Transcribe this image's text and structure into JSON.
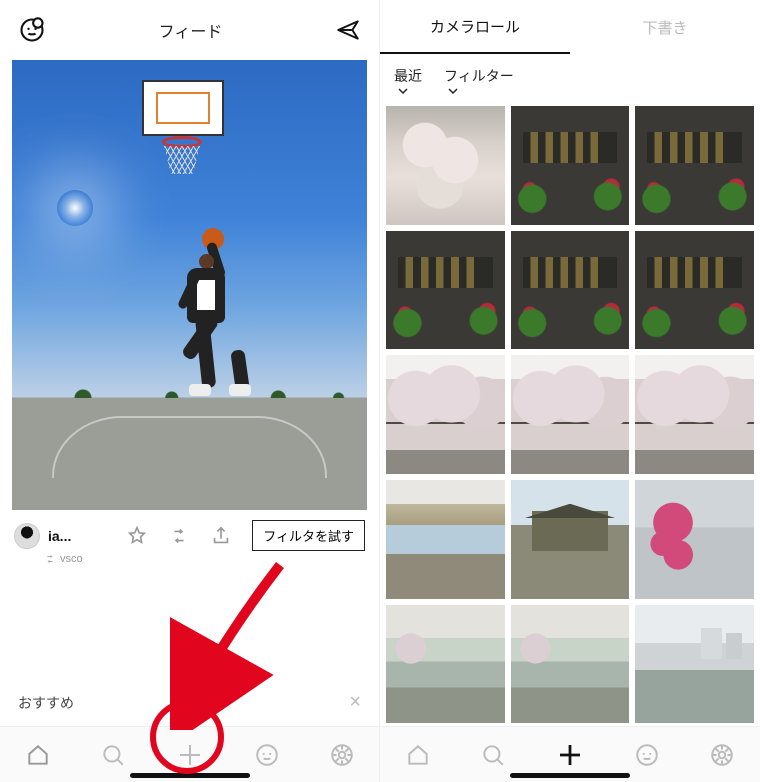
{
  "left": {
    "header": {
      "title": "フィード"
    },
    "post": {
      "username": "ia...",
      "source": "vsco",
      "try_filter_label": "フィルタを試す"
    },
    "suggest": {
      "label": "おすすめ"
    },
    "tabs": {
      "add_label": "+"
    }
  },
  "right": {
    "tabs": {
      "camera_roll": "カメラロール",
      "drafts": "下書き"
    },
    "sort": {
      "recent": "最近",
      "filter": "フィルター"
    },
    "tabs_bottom": {
      "add_label": "+"
    }
  }
}
